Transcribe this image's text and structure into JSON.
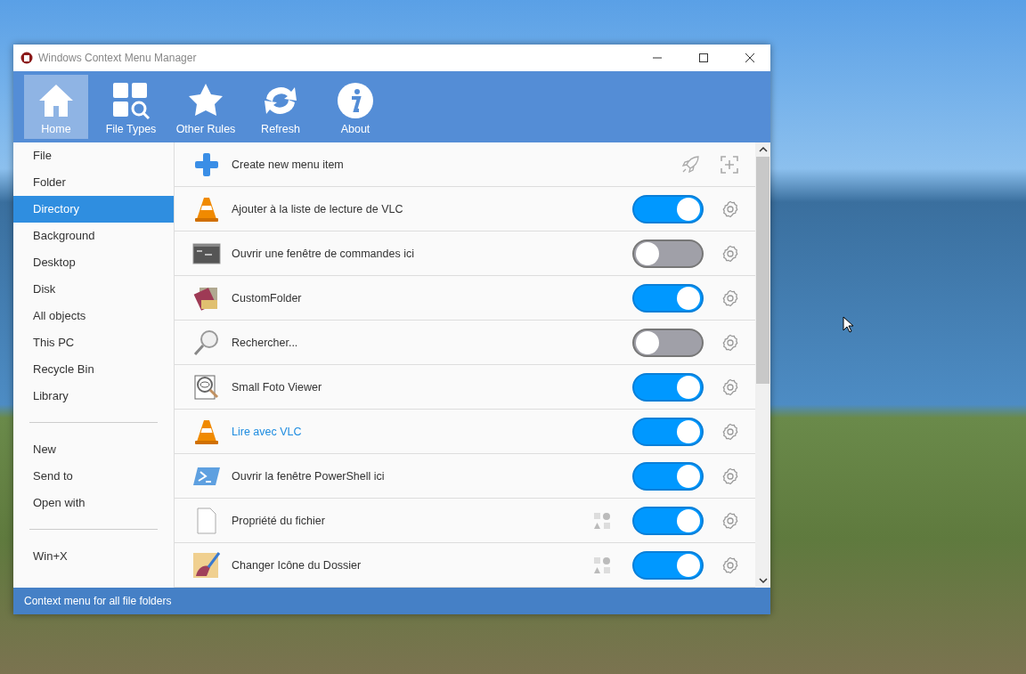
{
  "window": {
    "title": "Windows Context Menu Manager"
  },
  "toolbar": [
    {
      "label": "Home",
      "kind": "home",
      "selected": true
    },
    {
      "label": "File Types",
      "kind": "filetypes",
      "selected": false
    },
    {
      "label": "Other Rules",
      "kind": "star",
      "selected": false
    },
    {
      "label": "Refresh",
      "kind": "refresh",
      "selected": false
    },
    {
      "label": "About",
      "kind": "info",
      "selected": false
    }
  ],
  "sidebar": {
    "groups": [
      [
        {
          "label": "File",
          "selected": false
        },
        {
          "label": "Folder",
          "selected": false
        },
        {
          "label": "Directory",
          "selected": true
        },
        {
          "label": "Background",
          "selected": false
        },
        {
          "label": "Desktop",
          "selected": false
        },
        {
          "label": "Disk",
          "selected": false
        },
        {
          "label": "All objects",
          "selected": false
        },
        {
          "label": "This PC",
          "selected": false
        },
        {
          "label": "Recycle Bin",
          "selected": false
        },
        {
          "label": "Library",
          "selected": false
        }
      ],
      [
        {
          "label": "New",
          "selected": false
        },
        {
          "label": "Send to",
          "selected": false
        },
        {
          "label": "Open with",
          "selected": false
        }
      ],
      [
        {
          "label": "Win+X",
          "selected": false
        }
      ]
    ]
  },
  "create_item": {
    "label": "Create new menu item"
  },
  "items": [
    {
      "label": "Ajouter à la liste de lecture de VLC",
      "kind": "vlc",
      "on": true,
      "highlighted": false,
      "extra_icon": false
    },
    {
      "label": "Ouvrir une fenêtre de commandes ici",
      "kind": "cmd",
      "on": false,
      "highlighted": false,
      "extra_icon": false
    },
    {
      "label": "CustomFolder",
      "kind": "folder",
      "on": true,
      "highlighted": false,
      "extra_icon": false
    },
    {
      "label": "Rechercher...",
      "kind": "search",
      "on": false,
      "highlighted": false,
      "extra_icon": false
    },
    {
      "label": "Small Foto Viewer",
      "kind": "viewer",
      "on": true,
      "highlighted": false,
      "extra_icon": false
    },
    {
      "label": "Lire avec VLC",
      "kind": "vlc",
      "on": true,
      "highlighted": true,
      "extra_icon": false
    },
    {
      "label": "Ouvrir la fenêtre PowerShell ici",
      "kind": "powershell",
      "on": true,
      "highlighted": false,
      "extra_icon": false
    },
    {
      "label": "Propriété du fichier",
      "kind": "file",
      "on": true,
      "highlighted": false,
      "extra_icon": true
    },
    {
      "label": "Changer Icône du Dossier",
      "kind": "brush",
      "on": true,
      "highlighted": false,
      "extra_icon": true
    }
  ],
  "status_bar": {
    "text": "Context menu for all file folders"
  }
}
